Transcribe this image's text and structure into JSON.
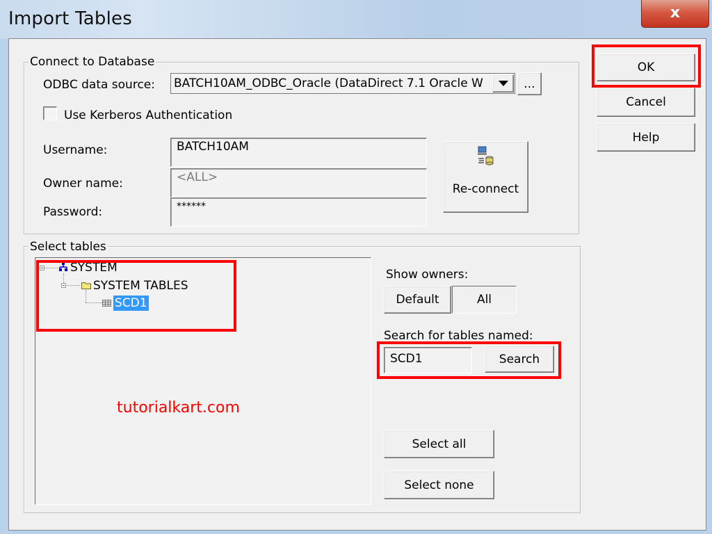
{
  "window": {
    "title": "Import Tables",
    "close_label": "x"
  },
  "dialog_buttons": {
    "ok": "OK",
    "cancel": "Cancel",
    "help": "Help"
  },
  "connect": {
    "group_label": "Connect to Database",
    "odbc_label": "ODBC data source:",
    "odbc_value": "BATCH10AM_ODBC_Oracle (DataDirect 7.1 Oracle W",
    "browse_label": "...",
    "kerberos_label": "Use Kerberos Authentication",
    "kerberos_checked": false,
    "username_label": "Username:",
    "username_value": "BATCH10AM",
    "owner_label": "Owner name:",
    "owner_value": "<ALL>",
    "password_label": "Password:",
    "password_value": "******",
    "reconnect_label": "Re-connect"
  },
  "select_tables": {
    "group_label": "Select tables",
    "tree": [
      {
        "label": "SYSTEM",
        "icon": "database-schema-icon",
        "level": 0
      },
      {
        "label": "SYSTEM TABLES",
        "icon": "folder-icon",
        "level": 1
      },
      {
        "label": "SCD1",
        "icon": "table-icon",
        "level": 2,
        "selected": true
      }
    ],
    "show_owners_label": "Show owners:",
    "default_label": "Default",
    "all_label": "All",
    "search_label": "Search for tables named:",
    "search_value": "SCD1",
    "search_button": "Search",
    "select_all": "Select all",
    "select_none": "Select none"
  },
  "watermark": "tutorialkart.com",
  "colors": {
    "highlight_red": "#ff0000",
    "selection_blue": "#3399ff"
  }
}
